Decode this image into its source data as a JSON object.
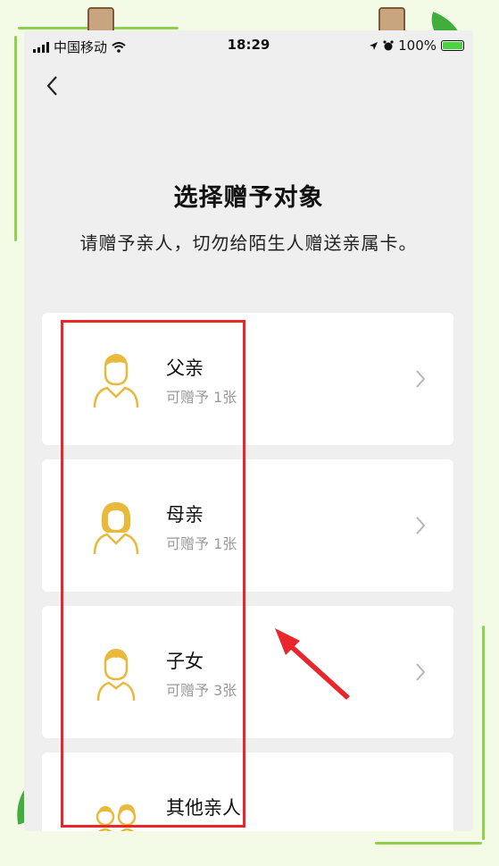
{
  "status_bar": {
    "carrier": "中国移动",
    "time": "18:29",
    "battery": "100%"
  },
  "page": {
    "title": "选择赠予对象",
    "subtitle": "请赠予亲人，切勿给陌生人赠送亲属卡。"
  },
  "recipients": [
    {
      "name": "父亲",
      "quota": "可赠予 1张",
      "icon": "father-avatar-icon"
    },
    {
      "name": "母亲",
      "quota": "可赠予 1张",
      "icon": "mother-avatar-icon"
    },
    {
      "name": "子女",
      "quota": "可赠予 3张",
      "icon": "child-avatar-icon"
    },
    {
      "name": "其他亲人",
      "quota": "",
      "icon": "relatives-avatar-icon"
    }
  ],
  "colors": {
    "avatar": "#e9b93c",
    "highlight": "#e8262b",
    "background": "#efefef",
    "frame": "#8fd14f"
  }
}
